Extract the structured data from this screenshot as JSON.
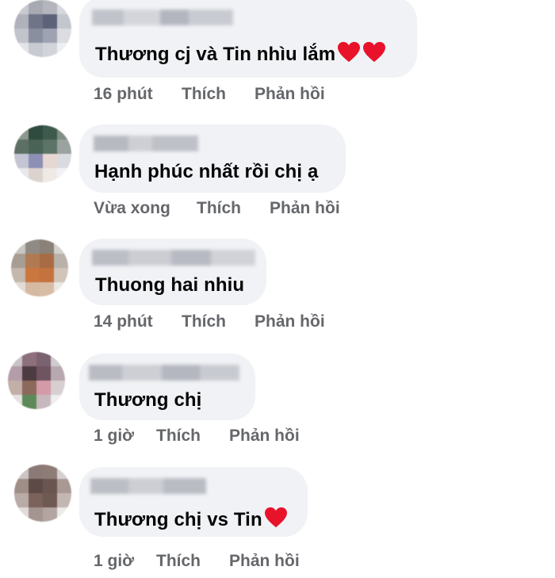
{
  "comments": [
    {
      "text": "Thương cj và Tin nhìu lắm",
      "trailing_icons": [
        "heart-icon",
        "heart-icon"
      ],
      "time": "16 phút",
      "like_label": "Thích",
      "reply_label": "Phản hồi"
    },
    {
      "text": "Hạnh phúc nhất rồi chị ạ",
      "trailing_icons": [],
      "time": "Vừa xong",
      "like_label": "Thích",
      "reply_label": "Phản hồi"
    },
    {
      "text": "Thuong hai nhiu",
      "trailing_icons": [],
      "time": "14 phút",
      "like_label": "Thích",
      "reply_label": "Phản hồi"
    },
    {
      "text": "Thương chị",
      "trailing_icons": [],
      "time": "1 giờ",
      "like_label": "Thích",
      "reply_label": "Phản hồi"
    },
    {
      "text": "Thương chị vs Tin",
      "trailing_icons": [
        "heart-icon"
      ],
      "time": "1 giờ",
      "like_label": "Thích",
      "reply_label": "Phản hồi"
    }
  ],
  "colors": {
    "bubble_bg": "#f0f2f5",
    "text": "#050505",
    "meta": "#65676b",
    "heart": "#e8132b"
  }
}
